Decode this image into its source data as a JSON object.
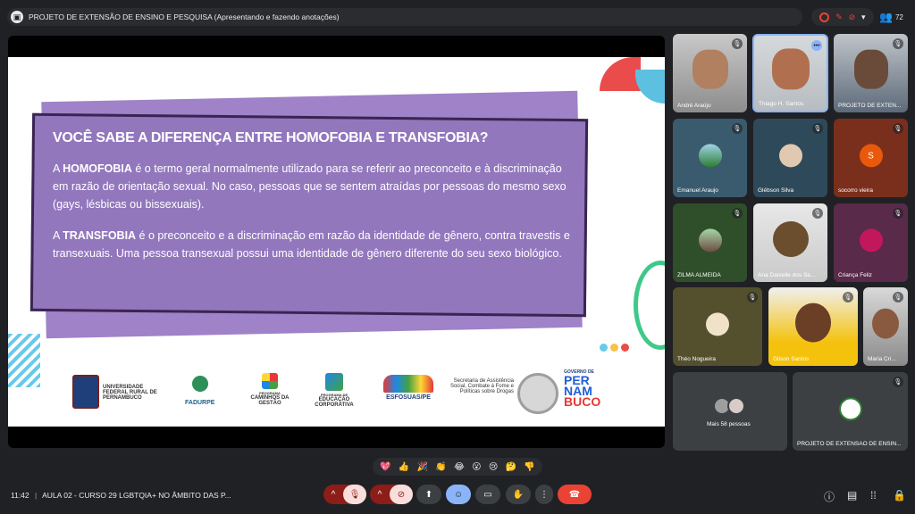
{
  "meeting": {
    "title": "PROJETO DE EXTENSÃO DE ENSINO E PESQUISA (Apresentando e fazendo anotações)",
    "participant_count": "72",
    "time": "11:42",
    "separator": "|",
    "meeting_name": "AULA 02 - CURSO 29 LGBTQIA+ NO ÂMBITO DAS P..."
  },
  "slide": {
    "heading": "VOCÊ SABE A DIFERENÇA ENTRE HOMOFOBIA E TRANSFOBIA?",
    "p1_prefix": "A ",
    "p1_term": "HOMOFOBIA",
    "p1_text": " é o termo geral normalmente utilizado para se referir ao preconceito e à discriminação em razão de orientação sexual. No caso, pessoas que se sentem atraídas por pessoas do mesmo sexo (gays, lésbicas ou bissexuais).",
    "p2_prefix": "A ",
    "p2_term": "TRANSFOBIA",
    "p2_text": " é o preconceito e a discriminação em razão da identidade de gênero, contra travestis e transexuais. Uma pessoa transexual possui uma identidade de gênero diferente do seu sexo biológico.",
    "logos": {
      "ufrpe": "UNIVERSIDADE FEDERAL RURAL DE PERNAMBUCO",
      "fadurpe": "FADURPE",
      "caminhos_top": "PROGRAMA",
      "caminhos": "CAMINHOS DA GESTÃO",
      "educacao_top": "PROGRAMA DE",
      "educacao": "EDUCAÇÃO CORPORATIVA",
      "esfosuas": "ESFOSUAS/PE",
      "secretaria": "Secretaria de Assistência Social, Combate à Fome e Políticas sobre Drogas",
      "governo": "GOVERNO DE",
      "pernambuco_1": "PER",
      "pernambuco_2": "NAM",
      "pernambuco_3": "BUCO"
    }
  },
  "participants": [
    {
      "name": "André Araújo"
    },
    {
      "name": "Thiago H. Santos"
    },
    {
      "name": "PROJETO DE EXTEN..."
    },
    {
      "name": "Emanuel Araujo"
    },
    {
      "name": "Glébson Silva"
    },
    {
      "name": "socorro vieira",
      "initial": "S"
    },
    {
      "name": "ZILMA ALMEIDA"
    },
    {
      "name": "Ana Danielle dos Sa..."
    },
    {
      "name": "Criança Feliz"
    },
    {
      "name": "Théo Nogueira"
    },
    {
      "name": "Gilson Santos"
    },
    {
      "name": "Maria Cri..."
    },
    {
      "name": "Mais 58 pessoas"
    },
    {
      "name": "PROJETO DE EXTENSÃO DE ENSIN..."
    }
  ],
  "reactions": [
    "💖",
    "👍",
    "🎉",
    "👏",
    "😂",
    "😮",
    "😢",
    "🤔",
    "👎"
  ],
  "colors": {
    "accent_red": "#ea4335",
    "slide_purple": "#9277bd",
    "active_blue": "#8ab4f8"
  }
}
